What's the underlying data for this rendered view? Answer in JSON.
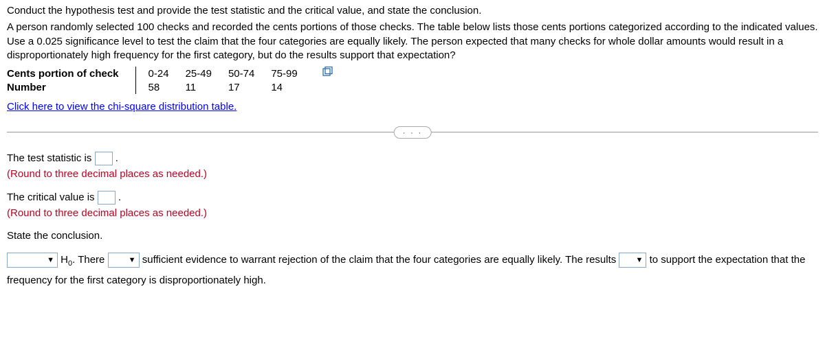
{
  "problem": {
    "line1": "Conduct the hypothesis test and provide the test statistic and the critical value, and state the conclusion.",
    "line2": "A person randomly selected 100 checks and recorded the cents portions of those checks. The table below lists those cents portions categorized according to the indicated values. Use a 0.025 significance level to test the claim that the four categories are equally likely. The person expected that many checks for whole dollar amounts would result in a disproportionately high frequency for the first category, but do the results support that expectation?"
  },
  "table": {
    "row1_label": "Cents portion of check",
    "row2_label": "Number",
    "c1": "0-24",
    "c2": "25-49",
    "c3": "50-74",
    "c4": "75-99",
    "v1": "58",
    "v2": "11",
    "v3": "17",
    "v4": "14"
  },
  "chi_link": "Click here to view the chi-square distribution table.",
  "ellipsis": "· · ·",
  "answers": {
    "test_stat_prefix": "The test statistic is ",
    "test_stat_suffix": ".",
    "round_hint": "(Round to three decimal places as needed.)",
    "crit_val_prefix": "The critical value is ",
    "crit_val_suffix": ".",
    "state_conclusion": "State the conclusion."
  },
  "conclusion": {
    "h0_prefix": " H",
    "h0_sub": "0",
    "h0_after": ". There ",
    "mid": " sufficient evidence to warrant rejection of the claim that the four categories are equally likely. The results ",
    "end": " to support the expectation that the frequency for the first category is disproportionately high.",
    "to": " to"
  }
}
